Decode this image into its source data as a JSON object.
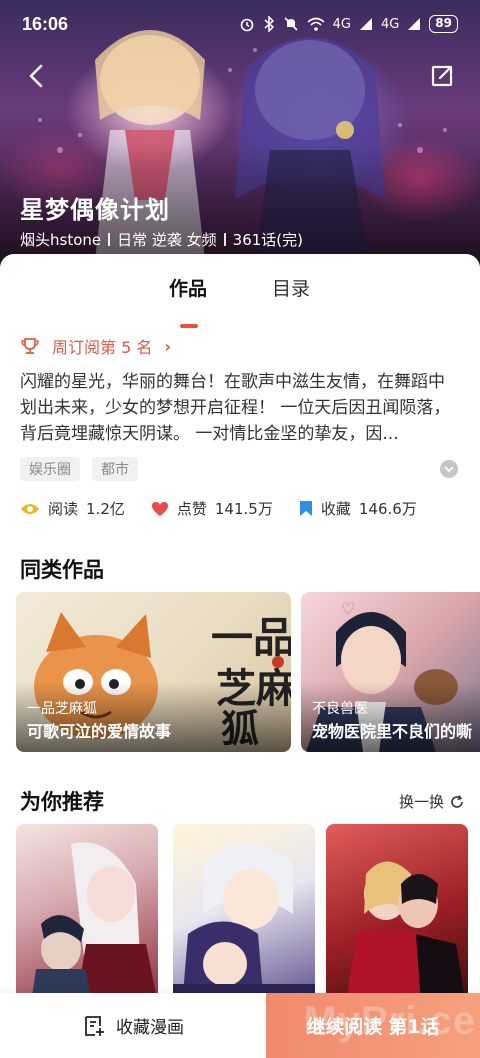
{
  "status_bar": {
    "time": "16:06",
    "icons": [
      "alarm-icon",
      "bluetooth-icon",
      "mute-icon",
      "wifi-icon",
      "signal-icon"
    ],
    "network_1": "4G",
    "network_2": "4G",
    "battery": "89"
  },
  "comic": {
    "title": "星梦偶像计划",
    "author": "烟头hstone",
    "genres": "日常 逆袭 女频",
    "chapters": "361话(完)"
  },
  "tabs": [
    {
      "label": "作品",
      "active": true
    },
    {
      "label": "目录",
      "active": false
    }
  ],
  "rank": {
    "label": "周订阅第 5 名"
  },
  "description": "闪耀的星光，华丽的舞台！在歌声中滋生友情，在舞蹈中划出未来，少女的梦想开启征程！ 一位天后因丑闻陨落，背后竟埋藏惊天阴谋。 一对情比金坚的挚友，因...",
  "tags": [
    "娱乐圈",
    "都市"
  ],
  "stats": {
    "read_label": "阅读",
    "read_value": "1.2亿",
    "like_label": "点赞",
    "like_value": "141.5万",
    "fav_label": "收藏",
    "fav_value": "146.6万"
  },
  "similar": {
    "title": "同类作品",
    "items": [
      {
        "name": "一品芝麻狐",
        "subtitle": "可歌可泣的爱情故事"
      },
      {
        "name": "不良兽医",
        "subtitle": "宠物医院里不良们的嘶"
      }
    ]
  },
  "recommend": {
    "title": "为你推荐",
    "refresh_label": "换一换"
  },
  "bottom": {
    "favorite_label": "收藏漫画",
    "continue_label": "继续阅读",
    "continue_chapter": "第1话",
    "watermark": "MyPri.ce"
  },
  "colors": {
    "accent": "#e8503a",
    "read_icon": "#f0b31e",
    "like_icon": "#e94a4a",
    "fav_icon": "#2d8fe5"
  }
}
